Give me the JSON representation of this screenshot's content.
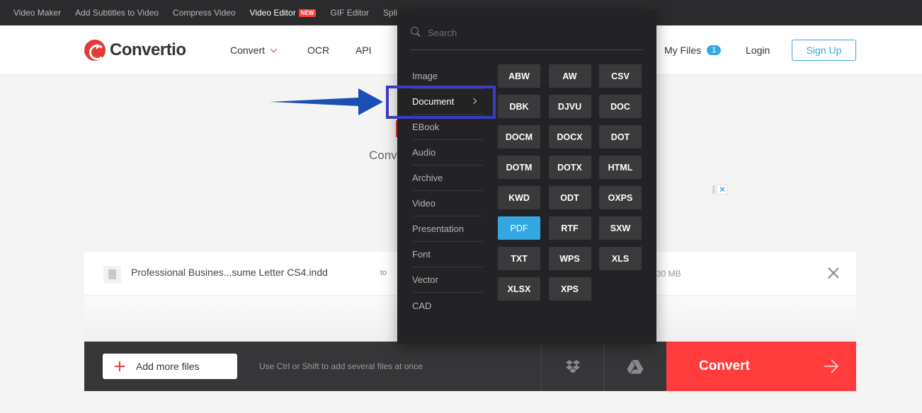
{
  "topbar": {
    "links": [
      {
        "label": "Video Maker",
        "active": false
      },
      {
        "label": "Add Subtitles to Video",
        "active": false
      },
      {
        "label": "Compress Video",
        "active": false
      },
      {
        "label": "Video Editor",
        "active": true,
        "badge": "NEW"
      },
      {
        "label": "GIF Editor",
        "active": false
      },
      {
        "label": "Split",
        "active": false
      }
    ]
  },
  "header": {
    "logo_text": "Convertio",
    "nav_convert": "Convert",
    "nav_ocr": "OCR",
    "nav_api": "API",
    "my_files_label": "My Files",
    "my_files_count": "1",
    "login": "Login",
    "signup": "Sign Up"
  },
  "background": {
    "subtitle_fragment": "Conv"
  },
  "dropdown": {
    "search_placeholder": "Search",
    "categories": [
      "Image",
      "Document",
      "EBook",
      "Audio",
      "Archive",
      "Video",
      "Presentation",
      "Font",
      "Vector",
      "CAD"
    ],
    "active_category": "Document",
    "formats": [
      "ABW",
      "AW",
      "CSV",
      "DBK",
      "DJVU",
      "DOC",
      "DOCM",
      "DOCX",
      "DOT",
      "DOTM",
      "DOTX",
      "HTML",
      "KWD",
      "ODT",
      "OXPS",
      "PDF",
      "RTF",
      "SXW",
      "TXT",
      "WPS",
      "XLS",
      "XLSX",
      "XPS"
    ],
    "selected_format": "PDF"
  },
  "file": {
    "name": "Professional Busines...sume Letter CS4.indd",
    "to_label": "to",
    "size_fragment": "30 MB"
  },
  "actions": {
    "add_more_files": "Add more files",
    "hint": "Use Ctrl or Shift to add several files at once",
    "convert": "Convert"
  },
  "colors": {
    "accent_red": "#ff3b3b",
    "accent_blue": "#33a8e0",
    "annotation_blue": "#3a3cc4",
    "arrow_blue": "#1a4fb4"
  }
}
